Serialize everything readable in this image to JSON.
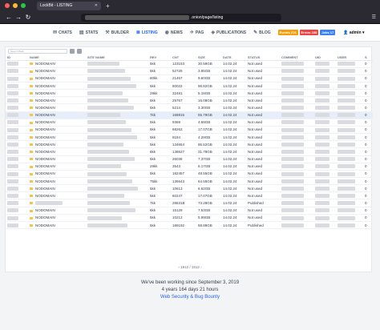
{
  "browser": {
    "tab_title": "LockBit - LISTING",
    "url_suffix": ".onion/page/listing"
  },
  "colors": {
    "accent": "#2563eb",
    "badge_events": "#f59e0b",
    "badge_errors": "#ef4444",
    "badge_jobs": "#3b82f6"
  },
  "header": {
    "menu": [
      {
        "label": "CHATS",
        "icon": "chat-icon"
      },
      {
        "label": "STATS",
        "icon": "stats-icon"
      },
      {
        "label": "BUILDER",
        "icon": "builder-icon"
      },
      {
        "label": "LISTING",
        "icon": "listing-icon",
        "active": true
      },
      {
        "label": "NEWS",
        "icon": "news-icon"
      },
      {
        "label": "PAG",
        "icon": "pag-icon"
      },
      {
        "label": "PUBLICATIONS",
        "icon": "publications-icon"
      },
      {
        "label": "BLOG",
        "icon": "blog-icon"
      }
    ],
    "badges": {
      "events": "Events 274",
      "errors": "Errors 108",
      "jobs": "Jobs 17"
    },
    "admin": "admin"
  },
  "listing": {
    "search_placeholder": "Search Back",
    "columns": [
      "ID",
      "NAME",
      "SITE NAME",
      "REV",
      "CNT",
      "SIZE",
      "DATE",
      "STATUS",
      "COMMENT",
      "UID",
      "USER",
      "S"
    ],
    "rows": [
      {
        "name": "NODOMAIN",
        "rev": "5kk",
        "cnt": "123153",
        "size": "30.59GB",
        "date": "14.02.24",
        "status": "Not used",
        "s": "0"
      },
      {
        "name": "NODOMAIN",
        "rev": "5kk",
        "cnt": "52725",
        "size": "3.85GB",
        "date": "14.02.24",
        "status": "Not used",
        "s": "0"
      },
      {
        "name": "NODOMAIN",
        "rev": "80kk",
        "cnt": "21467",
        "size": "9.60GB",
        "date": "14.02.24",
        "status": "Not used",
        "s": "0"
      },
      {
        "name": "NODOMAIN",
        "rev": "5kk",
        "cnt": "80022",
        "size": "96.82GB",
        "date": "14.02.24",
        "status": "Not used",
        "s": "0"
      },
      {
        "name": "NODOMAIN",
        "rev": "29kk",
        "cnt": "32481",
        "size": "5.18GB",
        "date": "14.02.24",
        "status": "Not used",
        "s": "0"
      },
      {
        "name": "NODOMAIN",
        "rev": "5kk",
        "cnt": "25767",
        "size": "16.08GB",
        "date": "14.02.24",
        "status": "Not used",
        "s": "0"
      },
      {
        "name": "NODOMAIN",
        "rev": "5kk",
        "cnt": "5214",
        "size": "3.30GB",
        "date": "14.02.24",
        "status": "Not used",
        "s": "0"
      },
      {
        "name": "NODOMAIN",
        "rev": "7kk",
        "cnt": "168815",
        "size": "55.79GB",
        "date": "14.02.24",
        "status": "Not used",
        "s": "0",
        "hl": true
      },
      {
        "name": "NODOMAIN",
        "rev": "5kk",
        "cnt": "9369",
        "size": "4.69GB",
        "date": "14.02.24",
        "status": "Not used",
        "s": "0"
      },
      {
        "name": "NODOMAIN",
        "rev": "5kk",
        "cnt": "68262",
        "size": "17.07GB",
        "date": "14.02.24",
        "status": "Not used",
        "s": "0"
      },
      {
        "name": "NODOMAIN",
        "rev": "5kk",
        "cnt": "8184",
        "size": "4.29GB",
        "date": "14.02.24",
        "status": "Not used",
        "s": "0"
      },
      {
        "name": "NODOMAIN",
        "rev": "5kk",
        "cnt": "134654",
        "size": "86.52GB",
        "date": "14.02.24",
        "status": "Not used",
        "s": "0"
      },
      {
        "name": "NODOMAIN",
        "rev": "8kk",
        "cnt": "138627",
        "size": "31.78GB",
        "date": "14.02.24",
        "status": "Not used",
        "s": "0"
      },
      {
        "name": "NODOMAIN",
        "rev": "5kk",
        "cnt": "26036",
        "size": "7.37GB",
        "date": "14.02.24",
        "status": "Not used",
        "s": "0"
      },
      {
        "name": "NODOMAIN",
        "rev": "29kk",
        "cnt": "3543",
        "size": "6.17GB",
        "date": "14.02.24",
        "status": "Not used",
        "s": "0"
      },
      {
        "name": "NODOMAIN",
        "rev": "5kk",
        "cnt": "182457",
        "size": "48.55GB",
        "date": "14.02.24",
        "status": "Not used",
        "s": "0"
      },
      {
        "name": "NODOMAIN",
        "rev": "75kk",
        "cnt": "135643",
        "size": "64.55GB",
        "date": "14.02.24",
        "status": "Not used",
        "s": "0"
      },
      {
        "name": "NODOMAIN",
        "rev": "5kk",
        "cnt": "10613",
        "size": "6.62GB",
        "date": "14.02.24",
        "status": "Not used",
        "s": "0"
      },
      {
        "name": "NODOMAIN",
        "rev": "5kk",
        "cnt": "60247",
        "size": "17.07GB",
        "date": "14.02.24",
        "status": "Not used",
        "s": "0"
      },
      {
        "name": "",
        "rev": "7kk",
        "cnt": "28531B",
        "size": "73.28GB",
        "date": "14.02.24",
        "status": "Published",
        "s": "0"
      },
      {
        "name": "NODOMAIN",
        "rev": "6kk",
        "cnt": "15129",
        "size": "7.53GB",
        "date": "14.02.24",
        "status": "Not used",
        "s": "0"
      },
      {
        "name": "NODOMAIN",
        "rev": "5kk",
        "cnt": "10212",
        "size": "5.99GB",
        "date": "14.02.24",
        "status": "Not used",
        "s": "0"
      },
      {
        "name": "NODOMAIN",
        "rev": "5kk",
        "cnt": "189192",
        "size": "58.89GB",
        "date": "14.02.24",
        "status": "Published",
        "s": "0"
      }
    ],
    "pager": "1912 / 1912"
  },
  "footer": {
    "line1": "We've been working since September 3, 2019",
    "line2": "4 years 164 days 21 hours",
    "link": "Web Security & Bug Bounty"
  }
}
